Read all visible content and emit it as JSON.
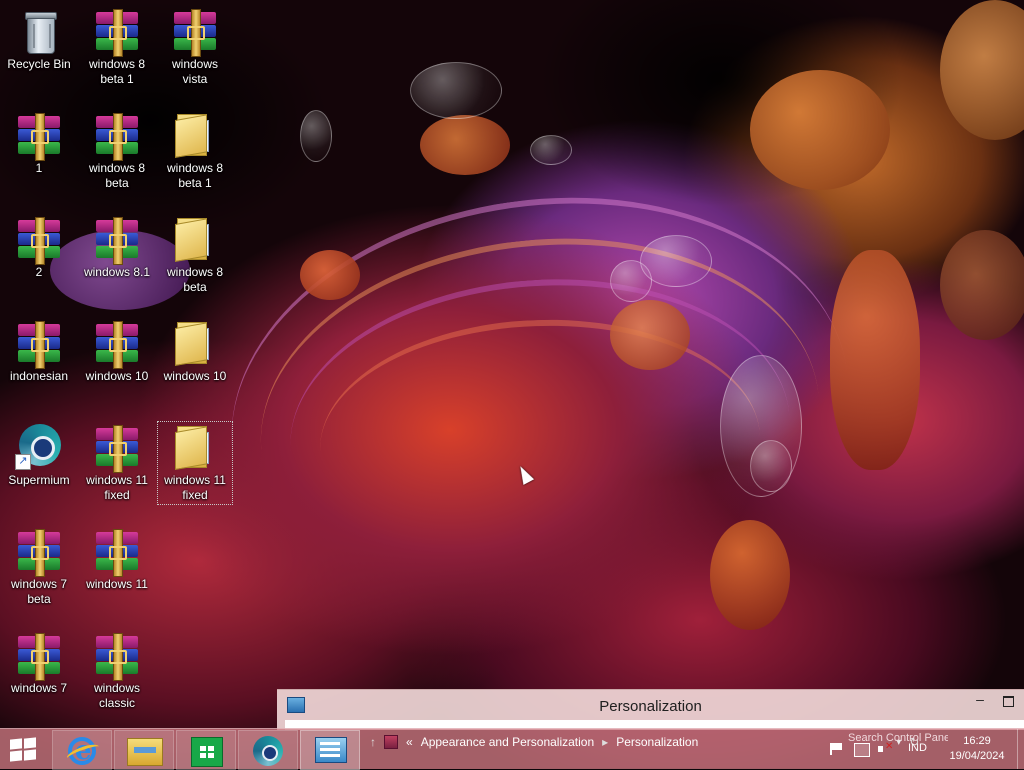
{
  "desktop": {
    "icons": [
      {
        "label": "Recycle Bin",
        "type": "recycle-bin"
      },
      {
        "label": "windows 8 beta 1",
        "type": "rar"
      },
      {
        "label": "windows vista",
        "type": "rar"
      },
      {
        "label": "1",
        "type": "rar"
      },
      {
        "label": "windows 8 beta",
        "type": "rar"
      },
      {
        "label": "windows 8 beta 1",
        "type": "folder"
      },
      {
        "label": "2",
        "type": "rar"
      },
      {
        "label": "windows 8.1",
        "type": "rar"
      },
      {
        "label": "windows 8 beta",
        "type": "folder"
      },
      {
        "label": "indonesian",
        "type": "rar"
      },
      {
        "label": "windows 10",
        "type": "rar"
      },
      {
        "label": "windows 10",
        "type": "folder"
      },
      {
        "label": "Supermium",
        "type": "shortcut"
      },
      {
        "label": "windows 11 fixed",
        "type": "rar"
      },
      {
        "label": "windows 11 fixed",
        "type": "folder"
      },
      {
        "label": "windows 7 beta",
        "type": "rar"
      },
      {
        "label": "windows 11",
        "type": "rar"
      },
      {
        "label": "windows 7",
        "type": "rar"
      },
      {
        "label": "windows classic",
        "type": "rar"
      }
    ]
  },
  "window": {
    "title": "Personalization",
    "minimize_label": "–",
    "breadcrumb_sep": "«",
    "breadcrumb": [
      "Appearance and Personalization",
      "Personalization"
    ],
    "search_placeholder": "Search Control Panel"
  },
  "taskbar": {
    "apps": [
      {
        "name": "Internet Explorer",
        "icon": "ie-icon",
        "state": "pinned"
      },
      {
        "name": "File Explorer",
        "icon": "folder-icon",
        "state": "pinned"
      },
      {
        "name": "Store",
        "icon": "store-icon",
        "state": "pinned"
      },
      {
        "name": "Supermium",
        "icon": "supermium-icon",
        "state": "pinned"
      },
      {
        "name": "Control Panel",
        "icon": "control-panel-icon",
        "state": "active"
      }
    ],
    "tray": {
      "language": "IND",
      "time": "16:29",
      "date": "19/04/2024"
    }
  },
  "colors": {
    "taskbar": "#cd7882",
    "accent": "#2a8ae8"
  }
}
